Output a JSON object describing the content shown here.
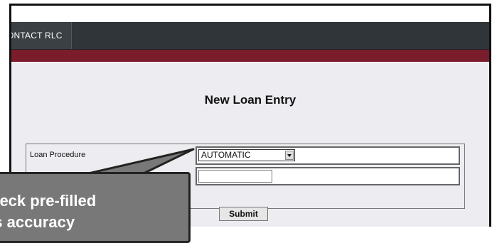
{
  "nav": {
    "items": [
      {
        "label": "ONTACT RLC"
      }
    ]
  },
  "colors": {
    "navbar": "#2f3538",
    "accent": "#7b1c2c",
    "content_bg": "#ededf1",
    "callout": "#787878"
  },
  "form": {
    "title": "New Loan Entry",
    "loan_procedure_label": "Loan Procedure",
    "loan_procedure_value": "AUTOMATIC",
    "second_field_value": "",
    "submit_label": "Submit"
  },
  "callout": {
    "line1": "heck pre-filled",
    "line2": "’s accuracy"
  }
}
